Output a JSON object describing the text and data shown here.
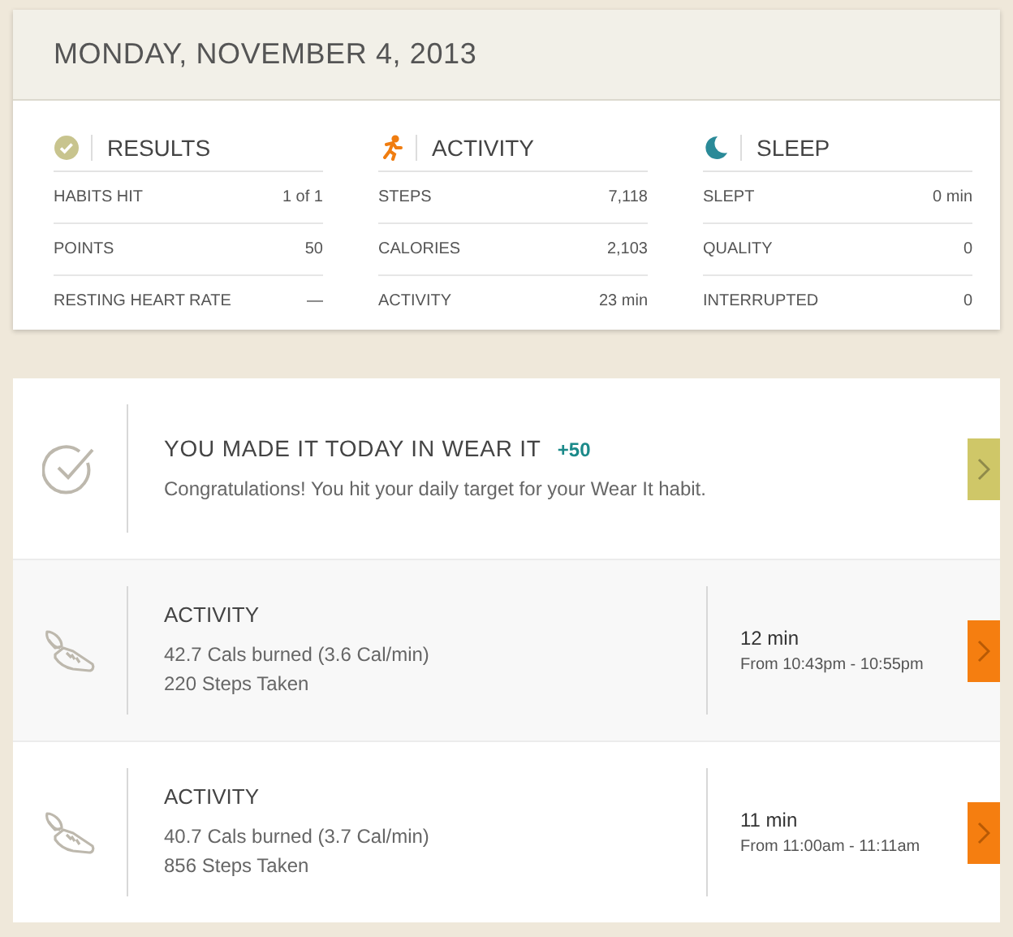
{
  "date_header": "MONDAY, NOVEMBER 4, 2013",
  "summary": [
    {
      "kind": "results",
      "title": "RESULTS",
      "rows": [
        {
          "label": "HABITS HIT",
          "value": "1 of 1"
        },
        {
          "label": "POINTS",
          "value": "50"
        },
        {
          "label": "RESTING HEART RATE",
          "value": "—"
        }
      ]
    },
    {
      "kind": "activity",
      "title": "ACTIVITY",
      "rows": [
        {
          "label": "STEPS",
          "value": "7,118"
        },
        {
          "label": "CALORIES",
          "value": "2,103"
        },
        {
          "label": "ACTIVITY",
          "value": "23 min"
        }
      ]
    },
    {
      "kind": "sleep",
      "title": "SLEEP",
      "rows": [
        {
          "label": "SLEPT",
          "value": "0 min"
        },
        {
          "label": "QUALITY",
          "value": "0"
        },
        {
          "label": "INTERRUPTED",
          "value": "0"
        }
      ]
    }
  ],
  "feed": [
    {
      "kind": "habit",
      "title": "YOU MADE IT TODAY IN WEAR IT",
      "points": "+50",
      "lines": [
        "Congratulations! You hit your daily target for your Wear It habit."
      ]
    },
    {
      "kind": "activity",
      "title": "ACTIVITY",
      "lines": [
        "42.7 Cals burned (3.6 Cal/min)",
        "220 Steps Taken"
      ],
      "duration": "12 min",
      "time_range": "From 10:43pm - 10:55pm"
    },
    {
      "kind": "activity",
      "title": "ACTIVITY",
      "lines": [
        "40.7 Cals burned (3.7 Cal/min)",
        "856 Steps Taken"
      ],
      "duration": "11 min",
      "time_range": "From 11:00am - 11:11am"
    }
  ]
}
